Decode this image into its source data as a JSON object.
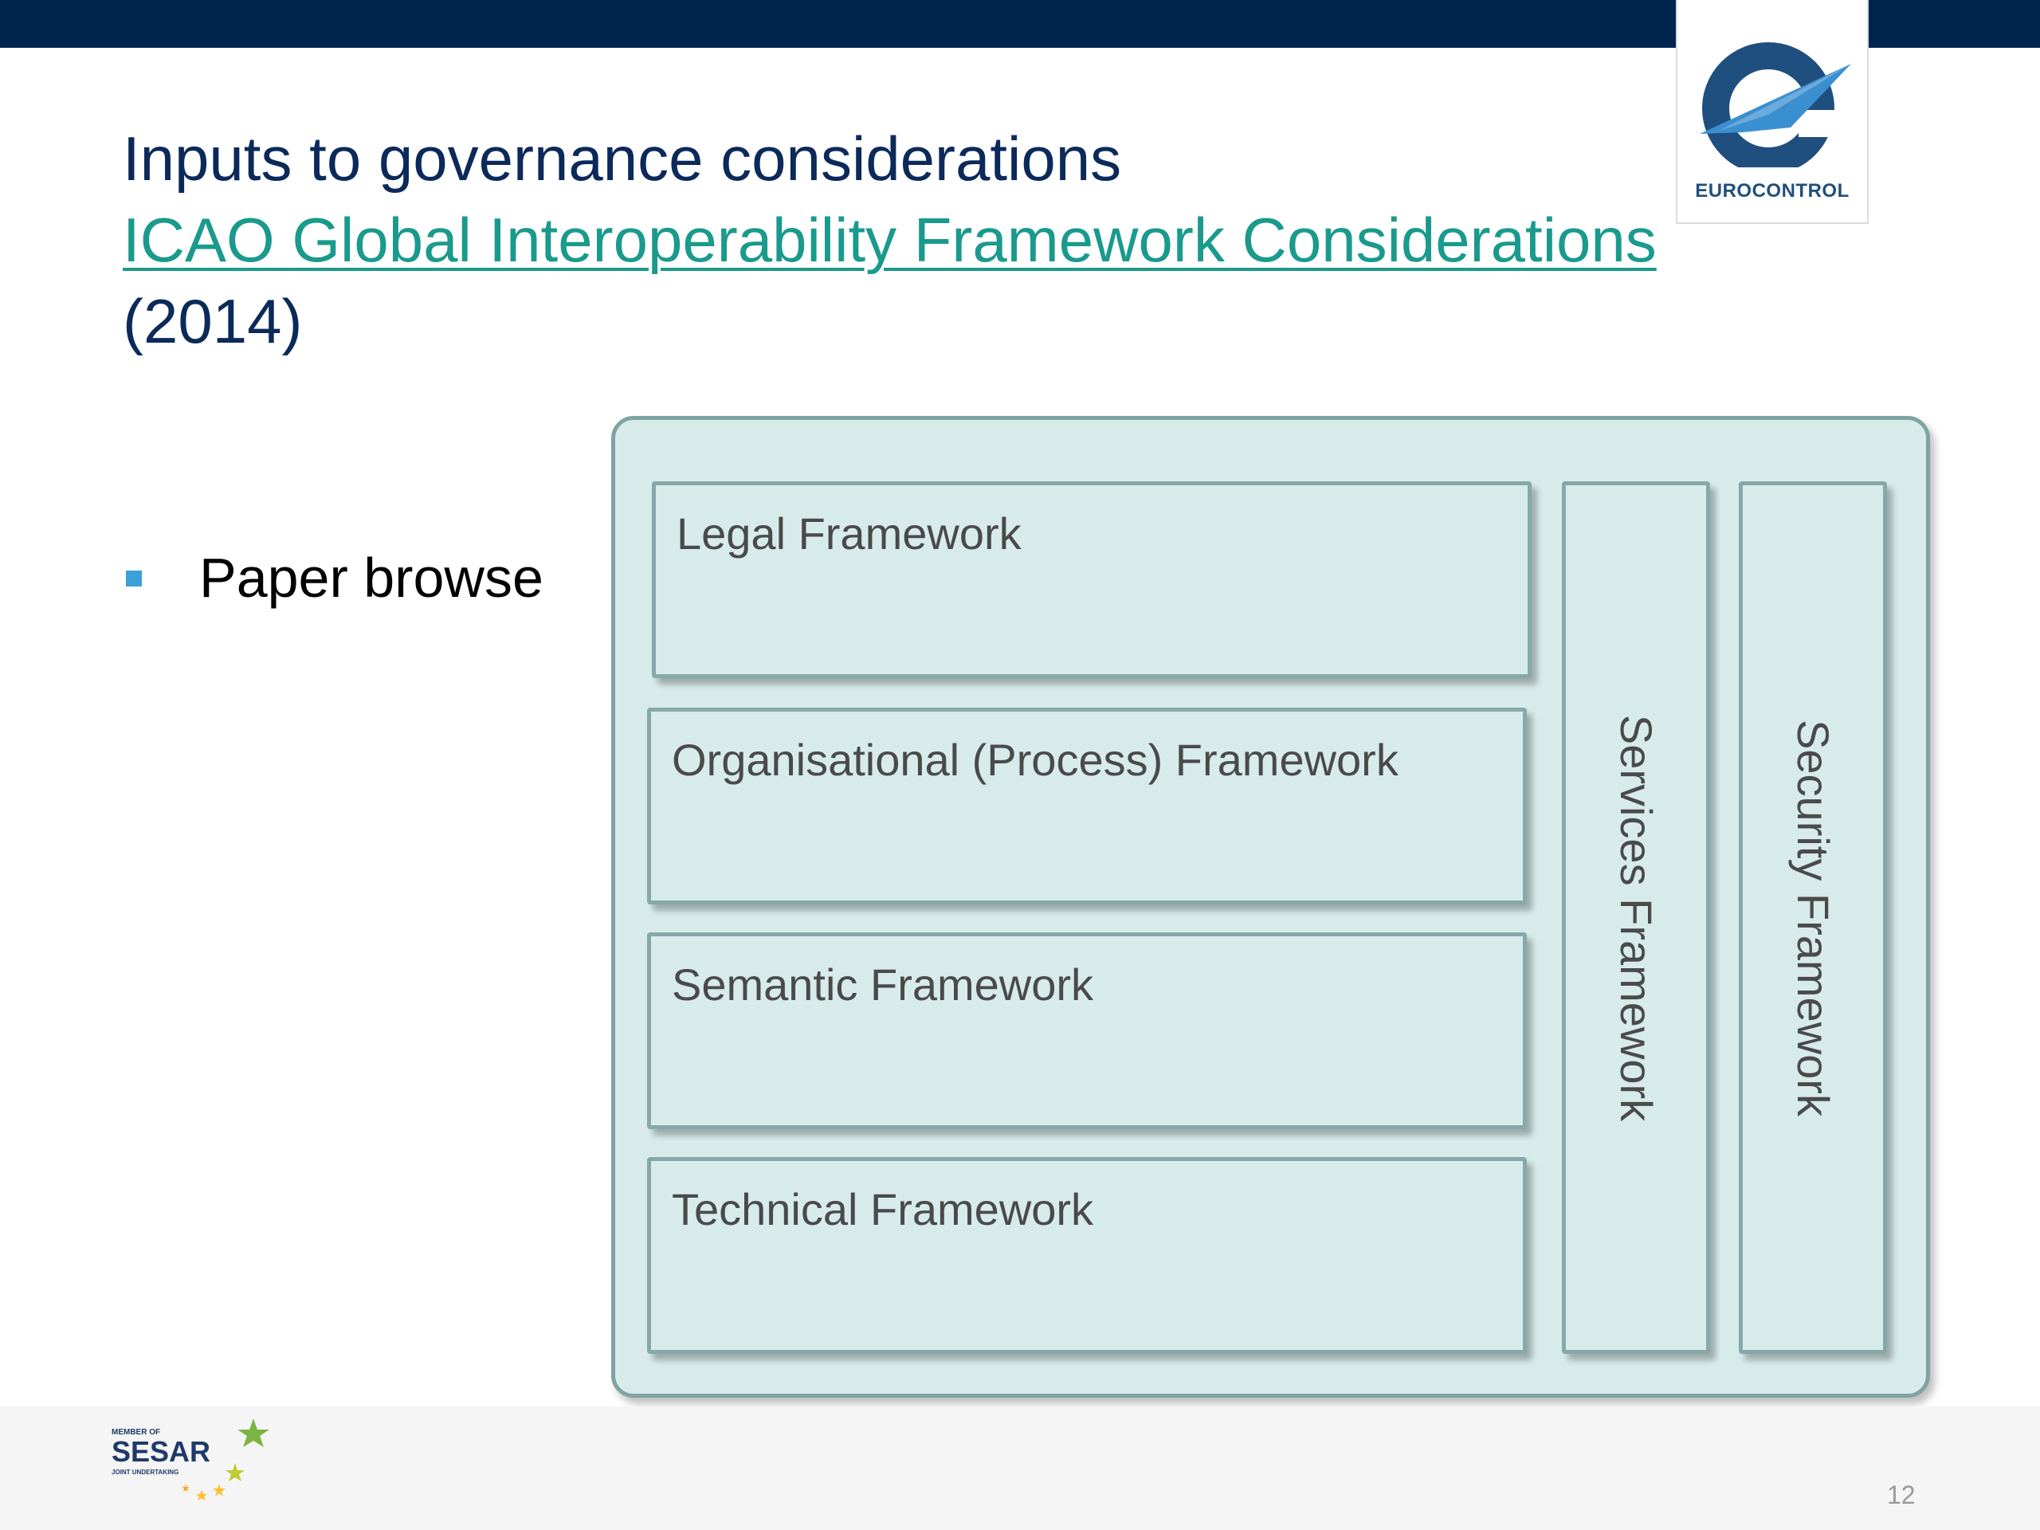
{
  "colors": {
    "top_bar": "#00264f",
    "title": "#0b2a5a",
    "link": "#1a9a8c",
    "bullet_marker": "#3aa0d5",
    "diagram_fill": "#d8ebeb",
    "box_border": "#87a8a8",
    "box_text": "#4a4a4a",
    "eurocontrol_blue": "#1f4f7f",
    "page_number": "#999999"
  },
  "logo": {
    "text": "EUROCONTROL",
    "icon": "eurocontrol-swoosh-icon"
  },
  "title": {
    "line1": "Inputs to governance considerations",
    "link_text": "ICAO Global Interoperability Framework Considerations",
    "year": "(2014)"
  },
  "bullets": [
    {
      "marker": "square-bullet-icon",
      "text": "Paper browse"
    }
  ],
  "diagram": {
    "layers": [
      {
        "label": "Legal Framework"
      },
      {
        "label": "Organisational (Process) Framework"
      },
      {
        "label": "Semantic Framework"
      },
      {
        "label": "Technical Framework"
      }
    ],
    "pillars": [
      {
        "label": "Services Framework"
      },
      {
        "label": "Security Framework"
      }
    ]
  },
  "footer": {
    "sesar_logo": {
      "main": "SESAR",
      "top": "MEMBER OF",
      "bottom": "JOINT UNDERTAKING",
      "icon": "sesar-stars-icon"
    },
    "page_number": "12"
  }
}
